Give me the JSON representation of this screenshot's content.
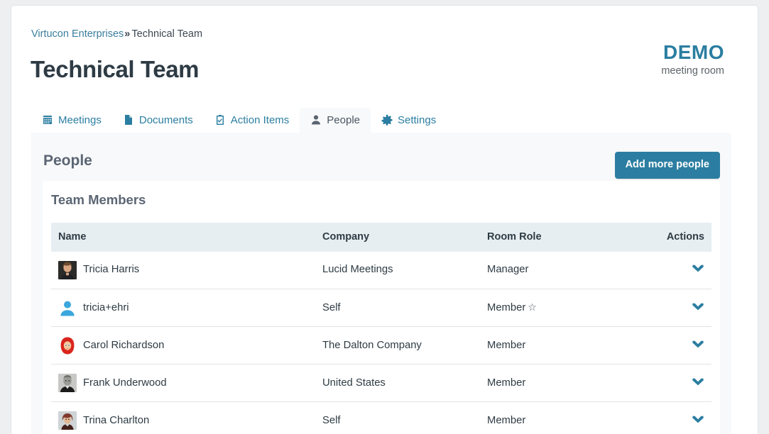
{
  "breadcrumb": {
    "parent": "Virtucon Enterprises",
    "separator": "»",
    "current": "Technical Team"
  },
  "page_title": "Technical Team",
  "brand": {
    "main": "DEMO",
    "sub": "meeting room",
    "color": "#2b7ea1"
  },
  "tabs": [
    {
      "label": "Meetings",
      "icon": "calendar-icon",
      "active": false
    },
    {
      "label": "Documents",
      "icon": "document-icon",
      "active": false
    },
    {
      "label": "Action Items",
      "icon": "checklist-icon",
      "active": false
    },
    {
      "label": "People",
      "icon": "person-icon",
      "active": true
    },
    {
      "label": "Settings",
      "icon": "gear-icon",
      "active": false
    }
  ],
  "panel": {
    "title": "People",
    "add_button": "Add more people",
    "card_title": "Team Members"
  },
  "table": {
    "headers": [
      "Name",
      "Company",
      "Room Role",
      "Actions"
    ],
    "rows": [
      {
        "name": "Tricia Harris",
        "company": "Lucid Meetings",
        "role": "Manager",
        "starred": false,
        "avatar": "photo-woman-dark",
        "action_icon": "chevron-down-icon"
      },
      {
        "name": "tricia+ehri",
        "company": "Self",
        "role": "Member",
        "starred": true,
        "avatar": "default-user-icon",
        "action_icon": "chevron-down-icon"
      },
      {
        "name": "Carol Richardson",
        "company": "The Dalton Company",
        "role": "Member",
        "starred": false,
        "avatar": "cartoon-red-hood",
        "action_icon": "chevron-down-icon"
      },
      {
        "name": "Frank Underwood",
        "company": "United States",
        "role": "Member",
        "starred": false,
        "avatar": "photo-man-grey",
        "action_icon": "chevron-down-icon"
      },
      {
        "name": "Trina Charlton",
        "company": "Self",
        "role": "Member",
        "starred": false,
        "avatar": "photo-woman-red",
        "action_icon": "chevron-down-icon"
      }
    ],
    "star_glyph": "☆"
  }
}
